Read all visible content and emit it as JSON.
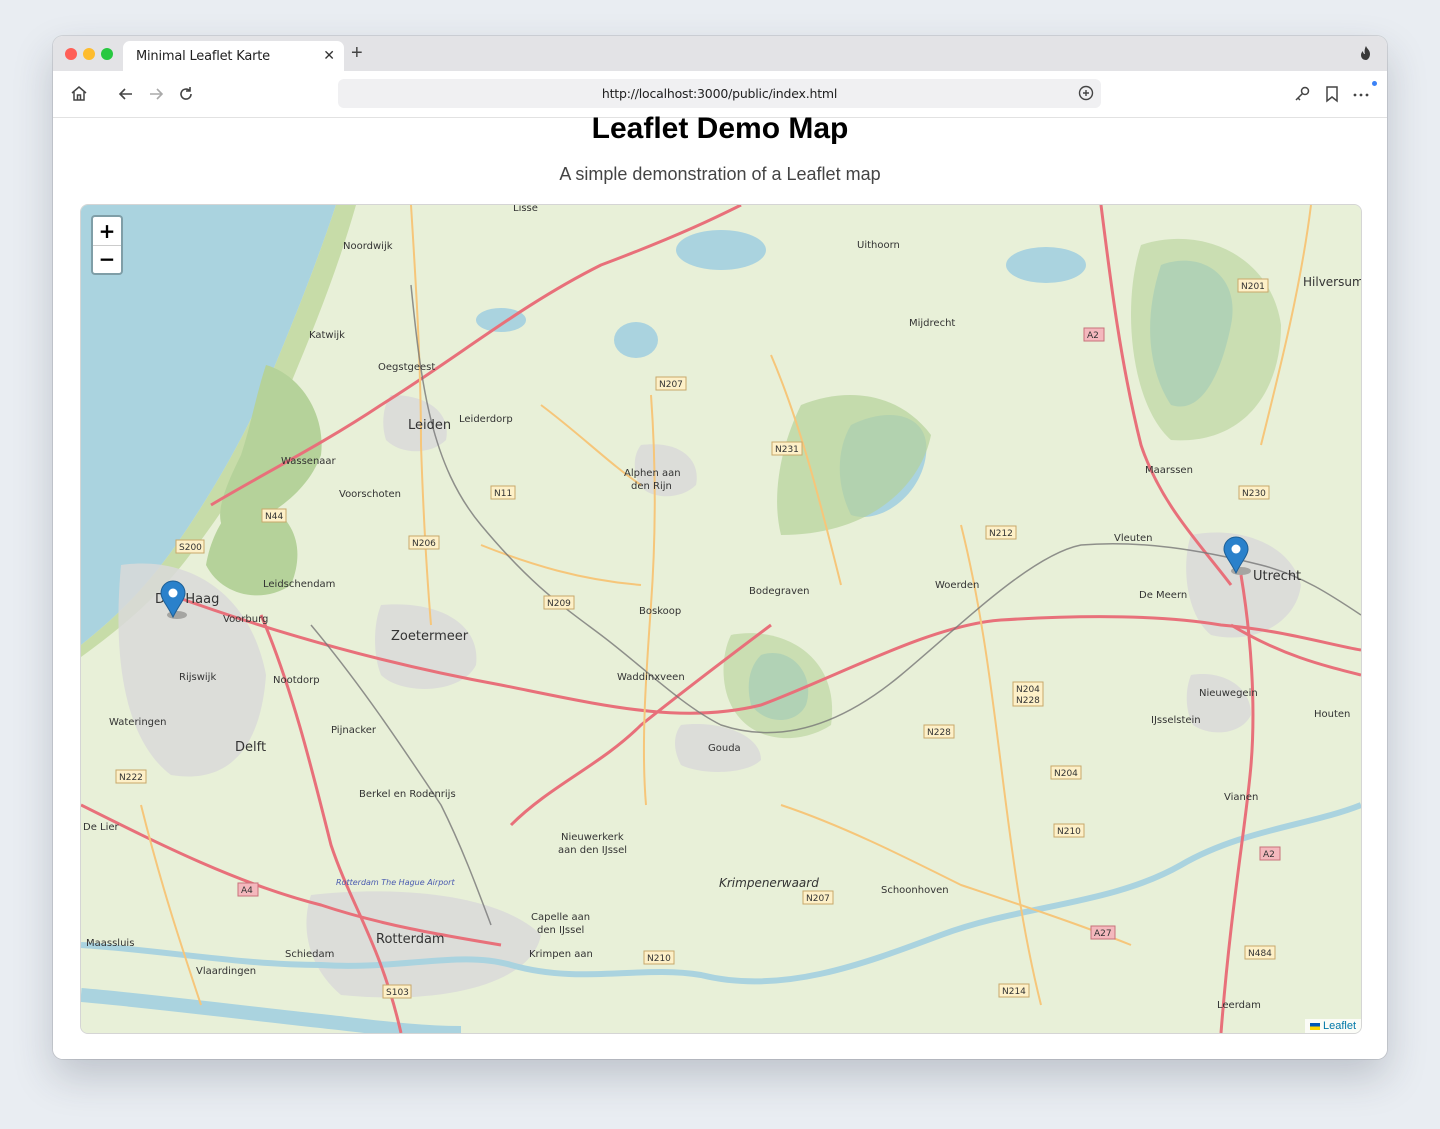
{
  "browser": {
    "tab_title": "Minimal Leaflet Karte",
    "url": "http://localhost:3000/public/index.html"
  },
  "page": {
    "title": "Leaflet Demo Map",
    "subtitle": "A simple demonstration of a Leaflet map"
  },
  "map": {
    "zoom_in": "+",
    "zoom_out": "−",
    "attribution": "Leaflet",
    "markers": [
      "Den Haag",
      "Utrecht"
    ],
    "places": [
      "Lisse",
      "Noordwijk",
      "Katwijk",
      "Oegstgeest",
      "Leiden",
      "Leiderdorp",
      "Wassenaar",
      "Voorschoten",
      "Alphen aan",
      "den Rijn",
      "Uithoorn",
      "Mijdrecht",
      "Hilversum",
      "Maarssen",
      "Vleuten",
      "De Meern",
      "Utrecht",
      "Nieuwegein",
      "IJsselstein",
      "Houten",
      "Vianen",
      "Woerden",
      "Bodegraven",
      "Boskoop",
      "Waddinxveen",
      "Gouda",
      "Zoetermeer",
      "Leidschendam",
      "Voorburg",
      "Den Haag",
      "Rijswijk",
      "Nootdorp",
      "Pijnacker",
      "Delft",
      "Wateringen",
      "De Lier",
      "Berkel en Rodenrijs",
      "Nieuwerkerk",
      "aan den IJssel",
      "Capelle aan",
      "den IJssel",
      "Krimpen aan",
      "Rotterdam",
      "Schiedam",
      "Vlaardingen",
      "Maassluis",
      "Schoonhoven",
      "Leerdam",
      "Krimpenerwaard",
      "Rotterdam The Hague Airport"
    ],
    "roads": [
      "N207",
      "N231",
      "N11",
      "N206",
      "N209",
      "N212",
      "N201",
      "N230",
      "N44",
      "S200",
      "N204",
      "N228",
      "N210",
      "N222",
      "A4",
      "A2",
      "A27",
      "N484",
      "N214",
      "S103"
    ]
  },
  "colors": {
    "water": "#aad3df",
    "land": "#e8f0d8",
    "forest": "#b5d29a",
    "urban": "#d9d9d9",
    "motorway": "#e8707a",
    "primary": "#f6c67a",
    "marker": "#2a81cb"
  }
}
